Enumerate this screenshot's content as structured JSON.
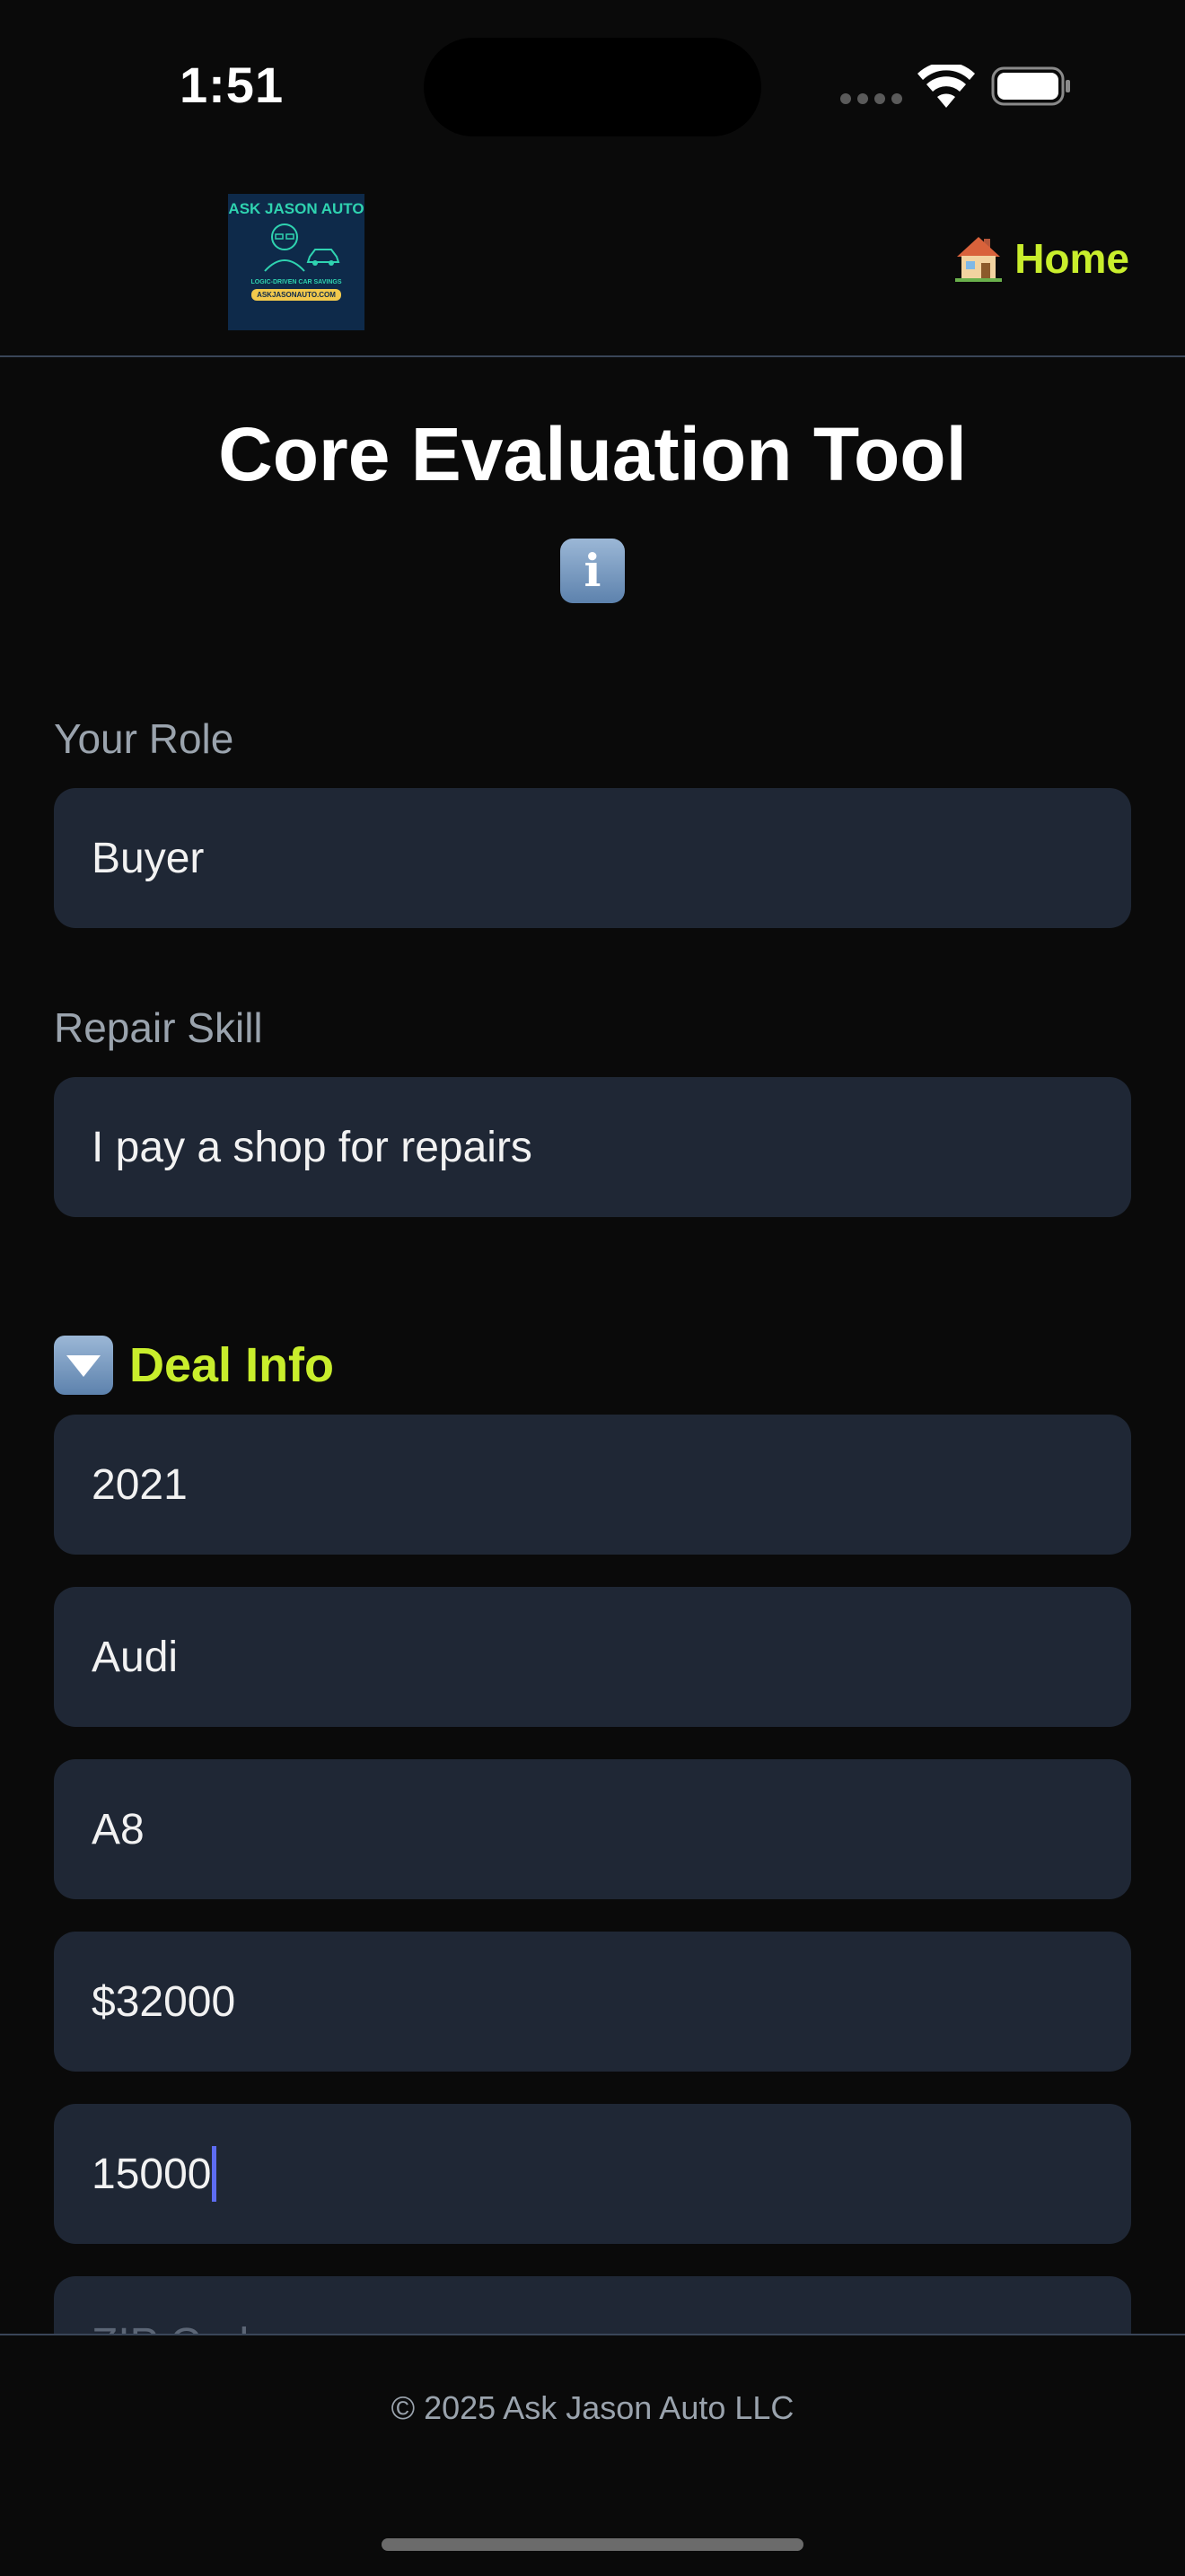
{
  "status_bar": {
    "time": "1:51"
  },
  "header": {
    "logo": {
      "title": "ASK JASON AUTO",
      "subtitle": "LOGIC-DRIVEN CAR SAVINGS",
      "url": "ASKJASONAUTO.COM"
    },
    "home_label": "Home"
  },
  "page": {
    "title": "Core Evaluation Tool",
    "info_glyph": "i"
  },
  "form": {
    "role": {
      "label": "Your Role",
      "value": "Buyer"
    },
    "repair_skill": {
      "label": "Repair Skill",
      "value": "I pay a shop for repairs"
    },
    "deal_info": {
      "heading": "Deal Info",
      "year": "2021",
      "make": "Audi",
      "model": "A8",
      "price": "$32000",
      "mileage": "15000",
      "zip_placeholder": "ZIP Code"
    }
  },
  "footer": {
    "copyright": "© 2025 Ask Jason Auto LLC"
  },
  "colors": {
    "accent": "#c9ee2c",
    "field_bg": "#1f2735",
    "background": "#0a0a0a"
  }
}
